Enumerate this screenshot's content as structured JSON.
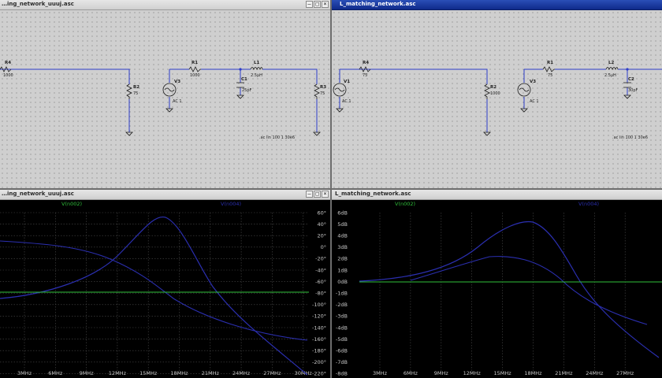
{
  "windows": {
    "tl": {
      "title": "…ing_network_uuuj.asc"
    },
    "tr": {
      "title": "L_matching_network.asc"
    },
    "bl": {
      "title": "…ing_network_uuuj.asc"
    },
    "br": {
      "title": "L_matching_network.asc"
    }
  },
  "window_controls": [
    "–",
    "□",
    "×"
  ],
  "schematic_left": {
    "R4": {
      "name": "R4",
      "value": "1000"
    },
    "R2": {
      "name": "R2",
      "value": "75"
    },
    "V3": {
      "name": "V3",
      "value": "AC 1"
    },
    "R1": {
      "name": "R1",
      "value": "1000"
    },
    "L1": {
      "name": "L1",
      "value": "2.5μH"
    },
    "C1": {
      "name": "C1",
      "value": "25pF"
    },
    "R3": {
      "name": "R3",
      "value": "75"
    },
    "directive": ".ac lin 100 1 30e6"
  },
  "schematic_right": {
    "V1": {
      "name": "V1",
      "value": "AC 1"
    },
    "R4": {
      "name": "R4",
      "value": "75"
    },
    "R2": {
      "name": "R2",
      "value": "1000"
    },
    "V3": {
      "name": "V3",
      "value": "AC 1"
    },
    "R1": {
      "name": "R1",
      "value": "75"
    },
    "L2": {
      "name": "L2",
      "value": "2.5μH"
    },
    "C2": {
      "name": "C2",
      "value": "30pF"
    },
    "directive": ".ac lin 100 1 30e6"
  },
  "plot_left": {
    "trace1": "V(n002)",
    "trace2": "V(n004)",
    "x_ticks": [
      "3MHz",
      "6MHz",
      "9MHz",
      "12MHz",
      "15MHz",
      "18MHz",
      "21MHz",
      "24MHz",
      "27MHz",
      "30MHz"
    ],
    "y_ticks": [
      "60°",
      "40°",
      "20°",
      "0°",
      "-20°",
      "-40°",
      "-60°",
      "-80°",
      "-100°",
      "-120°",
      "-140°",
      "-160°",
      "-180°",
      "-200°",
      "-220°"
    ]
  },
  "plot_right": {
    "trace1": "V(n002)",
    "trace2": "V(n004)",
    "x_ticks": [
      "3MHz",
      "6MHz",
      "9MHz",
      "12MHz",
      "15MHz",
      "18MHz",
      "21MHz",
      "24MHz",
      "27MHz"
    ],
    "y_ticks": [
      "6dB",
      "5dB",
      "4dB",
      "3dB",
      "2dB",
      "1dB",
      "0dB",
      "-1dB",
      "-2dB",
      "-3dB",
      "-4dB",
      "-5dB",
      "-6dB",
      "-7dB",
      "-8dB"
    ]
  },
  "colors": {
    "wire": "#2d3cc8",
    "trace_green": "#2fbf3a",
    "trace_blue": "#2b2fb0",
    "plot_bg": "#000000",
    "grid": "#4a4a4a",
    "active_title": "#12308f"
  }
}
